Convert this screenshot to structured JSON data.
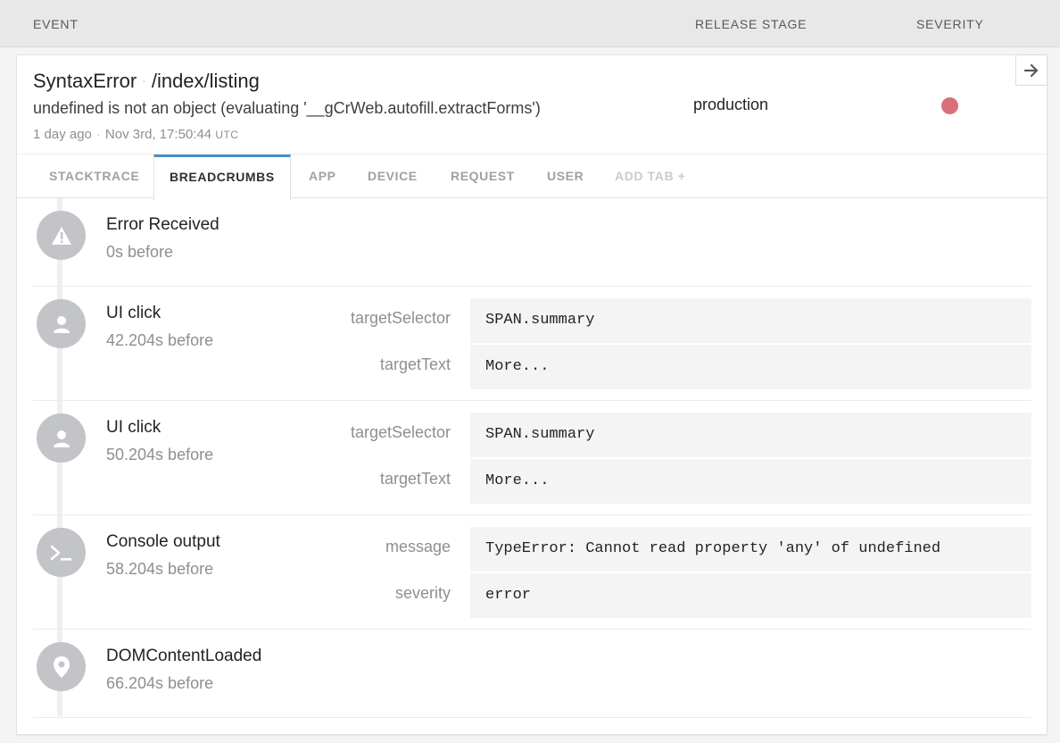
{
  "columns": {
    "event": "EVENT",
    "release_stage": "RELEASE STAGE",
    "severity": "SEVERITY"
  },
  "error": {
    "class": "SyntaxError",
    "context": "/index/listing",
    "message": "undefined is not an object (evaluating '__gCrWeb.autofill.extractForms')",
    "relative_time": "1 day ago",
    "timestamp": "Nov 3rd, 17:50:44",
    "timezone": "UTC",
    "release_stage": "production",
    "severity_color": "#db6f78"
  },
  "tabs": [
    {
      "label": "STACKTRACE"
    },
    {
      "label": "BREADCRUMBS"
    },
    {
      "label": "APP"
    },
    {
      "label": "DEVICE"
    },
    {
      "label": "REQUEST"
    },
    {
      "label": "USER"
    },
    {
      "label": "ADD TAB +"
    }
  ],
  "active_tab": "BREADCRUMBS",
  "breadcrumbs": [
    {
      "icon": "warning-icon",
      "title": "Error Received",
      "ago": "0s before",
      "meta": []
    },
    {
      "icon": "user-icon",
      "title": "UI click",
      "ago": "42.204s before",
      "meta": [
        {
          "key": "targetSelector",
          "value": "SPAN.summary"
        },
        {
          "key": "targetText",
          "value": "More..."
        }
      ]
    },
    {
      "icon": "user-icon",
      "title": "UI click",
      "ago": "50.204s before",
      "meta": [
        {
          "key": "targetSelector",
          "value": "SPAN.summary"
        },
        {
          "key": "targetText",
          "value": "More..."
        }
      ]
    },
    {
      "icon": "terminal-icon",
      "title": "Console output",
      "ago": "58.204s before",
      "meta": [
        {
          "key": "message",
          "value": "TypeError: Cannot read property 'any' of undefined"
        },
        {
          "key": "severity",
          "value": "error"
        }
      ]
    },
    {
      "icon": "location-pin-icon",
      "title": "DOMContentLoaded",
      "ago": "66.204s before",
      "meta": []
    }
  ]
}
